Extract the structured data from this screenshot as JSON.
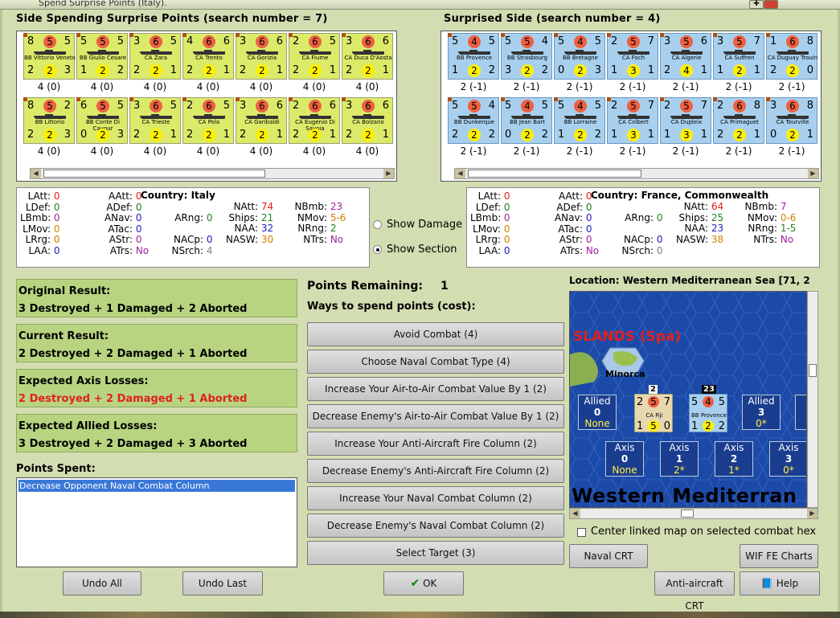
{
  "window": {
    "title": "Spend Surprise Points (Italy)."
  },
  "left_header": "Side Spending Surprise Points (search number = 7)",
  "right_header": "Surprised Side (search number = 4)",
  "italy_counters": [
    {
      "l": "8",
      "r": "5",
      "top": "5",
      "bl": "2",
      "bm": "2",
      "br": "3",
      "name": "BB Vittorio Veneto",
      "cap": "4 (0)"
    },
    {
      "l": "5",
      "r": "5",
      "top": "5",
      "bl": "1",
      "bm": "2",
      "br": "2",
      "name": "BB Giulio Cesare",
      "cap": "4 (0)"
    },
    {
      "l": "3",
      "r": "5",
      "top": "6",
      "bl": "2",
      "bm": "2",
      "br": "1",
      "name": "CA Zara",
      "cap": "4 (0)"
    },
    {
      "l": "4",
      "r": "6",
      "top": "6",
      "bl": "2",
      "bm": "2",
      "br": "1",
      "name": "CA Trento",
      "cap": "4 (0)"
    },
    {
      "l": "3",
      "r": "6",
      "top": "6",
      "bl": "2",
      "bm": "2",
      "br": "1",
      "name": "CA Gorizia",
      "cap": "4 (0)"
    },
    {
      "l": "2",
      "r": "5",
      "top": "6",
      "bl": "2",
      "bm": "2",
      "br": "1",
      "name": "CA Fiume",
      "cap": "4 (0)"
    },
    {
      "l": "3",
      "r": "6",
      "top": "6",
      "bl": "2",
      "bm": "2",
      "br": "1",
      "name": "CA Duca D'Aosta",
      "cap": "4 (0)"
    },
    {
      "l": "8",
      "r": "2",
      "top": "5",
      "bl": "2",
      "bm": "2",
      "br": "3",
      "name": "BB Littorio",
      "cap": "4 (0)"
    },
    {
      "l": "6",
      "r": "5",
      "top": "5",
      "bl": "0",
      "bm": "2",
      "br": "3",
      "name": "BB Conte Di Cavour",
      "cap": "4 (0)"
    },
    {
      "l": "3",
      "r": "5",
      "top": "6",
      "bl": "2",
      "bm": "2",
      "br": "1",
      "name": "CA Trieste",
      "cap": "4 (0)"
    },
    {
      "l": "2",
      "r": "5",
      "top": "6",
      "bl": "2",
      "bm": "2",
      "br": "1",
      "name": "CA Pola",
      "cap": "4 (0)"
    },
    {
      "l": "3",
      "r": "6",
      "top": "6",
      "bl": "2",
      "bm": "2",
      "br": "1",
      "name": "CA Garibaldi",
      "cap": "4 (0)"
    },
    {
      "l": "2",
      "r": "6",
      "top": "6",
      "bl": "2",
      "bm": "2",
      "br": "1",
      "name": "CA Eugenio Di Savoia",
      "cap": "4 (0)"
    },
    {
      "l": "3",
      "r": "6",
      "top": "6",
      "bl": "2",
      "bm": "2",
      "br": "1",
      "name": "CA Bolzano",
      "cap": "4 (0)"
    }
  ],
  "france_counters": [
    {
      "l": "5",
      "r": "5",
      "top": "4",
      "bl": "1",
      "bm": "2",
      "br": "2",
      "name": "BB Provence",
      "cap": "2 (-1)"
    },
    {
      "l": "5",
      "r": "4",
      "top": "5",
      "bl": "3",
      "bm": "2",
      "br": "2",
      "name": "BB Strasbourg",
      "cap": "2 (-1)"
    },
    {
      "l": "5",
      "r": "5",
      "top": "4",
      "bl": "0",
      "bm": "2",
      "br": "3",
      "name": "BB Bretagne",
      "cap": "2 (-1)"
    },
    {
      "l": "2",
      "r": "7",
      "top": "5",
      "bl": "1",
      "bm": "3",
      "br": "1",
      "name": "CA Foch",
      "cap": "2 (-1)"
    },
    {
      "l": "3",
      "r": "6",
      "top": "5",
      "bl": "2",
      "bm": "4",
      "br": "1",
      "name": "CA Algerie",
      "cap": "2 (-1)"
    },
    {
      "l": "3",
      "r": "7",
      "top": "5",
      "bl": "1",
      "bm": "2",
      "br": "1",
      "name": "CA Suffren",
      "cap": "2 (-1)"
    },
    {
      "l": "1",
      "r": "8",
      "top": "6",
      "bl": "2",
      "bm": "2",
      "br": "0",
      "name": "CA Duguay Trouin",
      "cap": "2 (-1)"
    },
    {
      "l": "5",
      "r": "4",
      "top": "5",
      "bl": "2",
      "bm": "2",
      "br": "2",
      "name": "BB Dunkerque",
      "cap": "2 (-1)"
    },
    {
      "l": "5",
      "r": "5",
      "top": "4",
      "bl": "0",
      "bm": "2",
      "br": "2",
      "name": "BB Jean Bart",
      "cap": "2 (-1)"
    },
    {
      "l": "5",
      "r": "5",
      "top": "4",
      "bl": "1",
      "bm": "2",
      "br": "2",
      "name": "BB Lorraine",
      "cap": "2 (-1)"
    },
    {
      "l": "2",
      "r": "7",
      "top": "5",
      "bl": "1",
      "bm": "3",
      "br": "1",
      "name": "CA Colbert",
      "cap": "2 (-1)"
    },
    {
      "l": "2",
      "r": "7",
      "top": "5",
      "bl": "1",
      "bm": "3",
      "br": "1",
      "name": "CA Dupleix",
      "cap": "2 (-1)"
    },
    {
      "l": "2",
      "r": "8",
      "top": "6",
      "bl": "2",
      "bm": "2",
      "br": "1",
      "name": "CA Primaguet",
      "cap": "2 (-1)"
    },
    {
      "l": "3",
      "r": "8",
      "top": "6",
      "bl": "0",
      "bm": "2",
      "br": "1",
      "name": "CA Tourville",
      "cap": "2 (-1)"
    }
  ],
  "italy_stats": {
    "country_label": "Country: Italy",
    "LAtt": "0",
    "LDef": "0",
    "LBmb": "0",
    "LMov": "0",
    "LRrg": "0",
    "LAA": "0",
    "AAtt": "0",
    "ADef": "0",
    "ANav": "0",
    "ATac": "0",
    "AStr": "0",
    "ATrs": "No",
    "ARng": "0",
    "NACp": "0",
    "NSrch": "4",
    "NAtt": "74",
    "Ships": "21",
    "NAA": "32",
    "NASW": "30",
    "NBmb": "23",
    "NMov": "5-6",
    "NRng": "2",
    "NTrs": "No"
  },
  "france_stats": {
    "country_label": "Country: France, Commonwealth",
    "LAtt": "0",
    "LDef": "0",
    "LBmb": "0",
    "LMov": "0",
    "LRrg": "0",
    "LAA": "0",
    "AAtt": "0",
    "ADef": "0",
    "ANav": "0",
    "ATac": "0",
    "AStr": "0",
    "ATrs": "No",
    "ARng": "0",
    "NACp": "0",
    "NSrch": "0",
    "NAtt": "64",
    "Ships": "25",
    "NAA": "23",
    "NASW": "38",
    "NBmb": "7",
    "NMov": "0-6",
    "NRng": "1-5",
    "NTrs": "No"
  },
  "show_damage_label": "Show Damage",
  "show_section_label": "Show Section",
  "results": {
    "original_title": "Original Result:",
    "original_value": "3 Destroyed + 1 Damaged + 2 Aborted",
    "current_title": "Current Result:",
    "current_value": "2 Destroyed + 2 Damaged + 1 Aborted",
    "axis_title": "Expected Axis Losses:",
    "axis_value": "2 Destroyed + 2 Damaged + 1 Aborted",
    "allied_title": "Expected Allied Losses:",
    "allied_value": "3 Destroyed + 2 Damaged + 3 Aborted"
  },
  "points_spent_label": "Points Spent:",
  "points_spent_items": [
    "Decrease Opponent Naval Combat Column"
  ],
  "points_remaining_label": "Points Remaining:",
  "points_remaining_value": "1",
  "ways_label": "Ways to spend points (cost):",
  "ways": [
    "Avoid Combat (4)",
    "Choose Naval Combat Type (4)",
    "Increase Your Air-to-Air Combat Value By 1 (2)",
    "Decrease Enemy's Air-to-Air Combat Value By 1 (2)",
    "Increase Your Anti-Aircraft Fire Column (2)",
    "Decrease Enemy's Anti-Aircraft Fire Column (2)",
    "Increase Your Naval Combat Column (2)",
    "Decrease Enemy's Naval Combat Column (2)",
    "Select Target (3)"
  ],
  "location_label": "Location: Western Mediterranean Sea [71, 2",
  "map": {
    "islands_label": "SLANDS (Spa)",
    "minorca": "Minorca",
    "sea_label": "Western Mediterran",
    "stack_a": "2",
    "stack_b": "23",
    "fiji": {
      "l": "2",
      "r": "7",
      "top": "5",
      "bl": "1",
      "bm": "5",
      "br": "0",
      "name": "CA Fiji"
    },
    "provence": {
      "l": "5",
      "r": "5",
      "top": "4",
      "bl": "1",
      "bm": "2",
      "br": "2",
      "name": "BB Provence"
    },
    "allied_boxes": [
      {
        "t": "Allied",
        "n": "0",
        "s": "None"
      },
      {
        "t": "Allied",
        "n": "3",
        "s": "0*"
      }
    ],
    "axis_boxes": [
      {
        "t": "Axis",
        "n": "0",
        "s": "None"
      },
      {
        "t": "Axis",
        "n": "1",
        "s": "2*"
      },
      {
        "t": "Axis",
        "n": "2",
        "s": "1*"
      },
      {
        "t": "Axis",
        "n": "3",
        "s": "0*"
      }
    ]
  },
  "center_map_label": "Center linked map on selected combat hex",
  "buttons": {
    "naval_crt": "Naval CRT",
    "wif_charts": "WIF FE Charts",
    "undo_all": "Undo All",
    "undo_last": "Undo Last",
    "ok": "OK",
    "aa_crt": "Anti-aircraft CRT",
    "help": "Help"
  },
  "colors": {
    "italy": "#dcea6a",
    "france": "#a8d0ee",
    "results": "#b8d480",
    "frame": "#d3ddb2"
  }
}
